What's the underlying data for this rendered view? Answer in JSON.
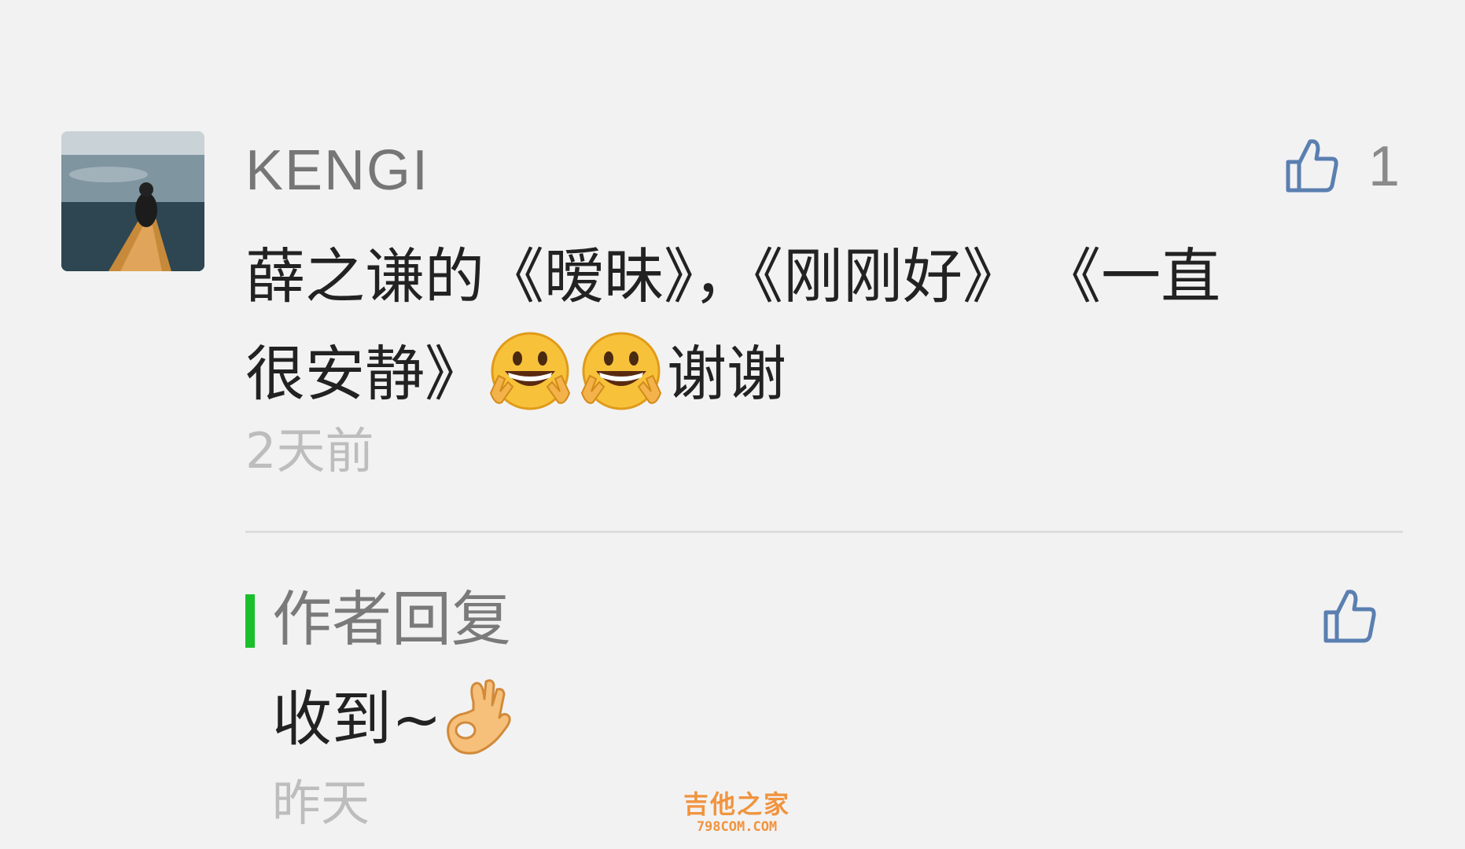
{
  "comment": {
    "username": "KENGI",
    "like_count": "1",
    "text_line1": "薛之谦的《暧昧》，《刚刚好》  《一直",
    "text_line2_before": "很安静》",
    "emoji_name": "grinning-peace-face-emoji",
    "text_line2_after": "谢谢",
    "time": "2天前"
  },
  "reply": {
    "title": "作者回复",
    "text": "收到~",
    "emoji_name": "ok-hand-emoji",
    "time": "昨天"
  },
  "watermark": {
    "cn": "吉他之家",
    "en": "798COM.COM"
  },
  "colors": {
    "background": "#f2f2f3",
    "like_icon": "#5a7fb0",
    "author_bar": "#1bbf2b",
    "watermark": "#f08a2b"
  },
  "icons": {
    "like": "thumbs-up-icon"
  }
}
